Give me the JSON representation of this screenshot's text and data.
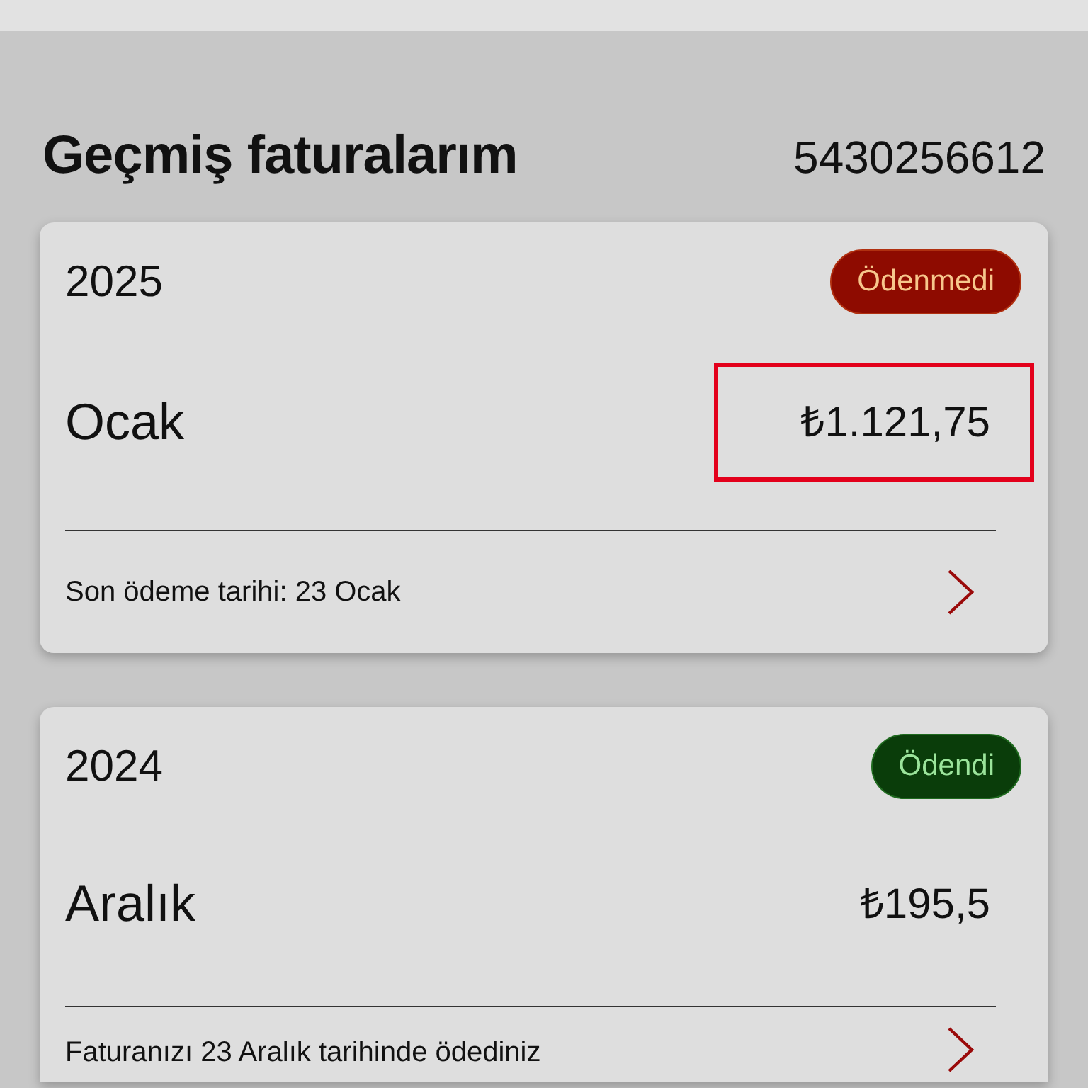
{
  "page": {
    "title": "Geçmiş faturalarım",
    "phone_number": "5430256612"
  },
  "bills": [
    {
      "year": "2025",
      "status": {
        "kind": "unpaid",
        "label": "Ödenmedi"
      },
      "month": "Ocak",
      "amount": "₺1.121,75",
      "highlighted": true,
      "footer": "Son ödeme tarihi: 23 Ocak"
    },
    {
      "year": "2024",
      "status": {
        "kind": "paid",
        "label": "Ödendi"
      },
      "month": "Aralık",
      "amount": "₺195,5",
      "highlighted": false,
      "footer": "Faturanızı 23 Aralık tarihinde ödediniz"
    }
  ]
}
